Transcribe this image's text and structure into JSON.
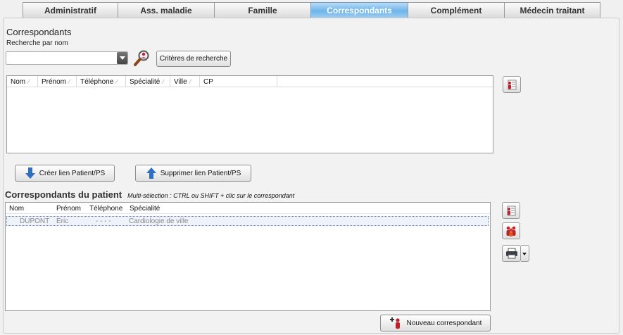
{
  "tabs": [
    {
      "label": "Administratif"
    },
    {
      "label": "Ass. maladie"
    },
    {
      "label": "Famille"
    },
    {
      "label": "Correspondants"
    },
    {
      "label": "Complément"
    },
    {
      "label": "Médecin traitant"
    }
  ],
  "active_tab": "Correspondants",
  "search": {
    "section_title": "Correspondants",
    "label": "Recherche par nom",
    "value": "",
    "criteria_button": "Critères de recherche"
  },
  "results_grid": {
    "columns": [
      "Nom",
      "Prénom",
      "Téléphone",
      "Spécialité",
      "Ville",
      "CP"
    ],
    "rows": []
  },
  "actions": {
    "create_link": "Créer lien Patient/PS",
    "delete_link": "Supprimer lien Patient/PS"
  },
  "patient_correspondents": {
    "title": "Correspondants du patient",
    "hint": "Multi-sélection : CTRL ou SHIFT + clic sur le correspondant",
    "columns": [
      "Nom",
      "Prénom",
      "Téléphone",
      "Spécialité"
    ],
    "rows": [
      {
        "nom": "DUPONT",
        "prenom": "Eric",
        "telephone": "- - - -",
        "specialite": "Cardiologie de ville"
      }
    ]
  },
  "new_button": "Nouveau correspondant",
  "colors": {
    "active_tab": "#6eb4ea",
    "selection_border": "#5a78c8",
    "arrow_blue": "#2f6fc0",
    "icon_red": "#c0202a"
  },
  "icons": {
    "combo": "chevron-down-icon",
    "search": "magnifier-person-icon",
    "create": "arrow-down-icon",
    "delete": "arrow-up-icon",
    "detail": "person-card-icon",
    "group": "persons-group-icon",
    "print": "printer-icon",
    "new": "person-plus-icon"
  }
}
